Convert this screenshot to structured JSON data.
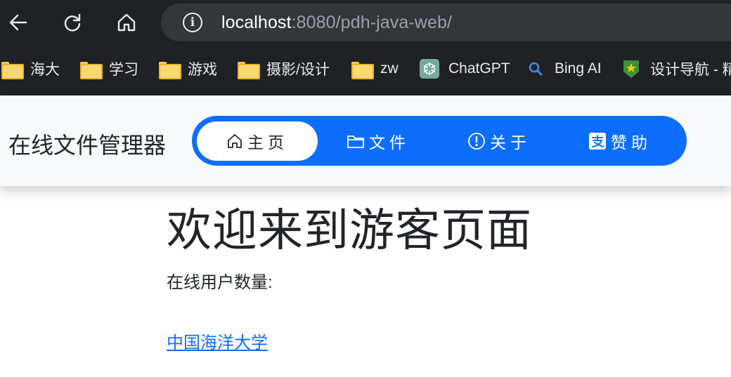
{
  "browser": {
    "url_host": "localhost",
    "url_path": ":8080/pdh-java-web/",
    "bookmarks": [
      {
        "label": "海大",
        "icon": "folder-icon"
      },
      {
        "label": "学习",
        "icon": "folder-icon"
      },
      {
        "label": "游戏",
        "icon": "folder-icon"
      },
      {
        "label": "摄影/设计",
        "icon": "folder-icon"
      },
      {
        "label": "zw",
        "icon": "folder-icon"
      },
      {
        "label": "ChatGPT",
        "icon": "chatgpt-icon"
      },
      {
        "label": "Bing AI",
        "icon": "search-icon"
      },
      {
        "label": "设计导航 - 精",
        "icon": "star-shield-icon"
      }
    ]
  },
  "site": {
    "brand": "在线文件管理器",
    "nav": [
      {
        "label": "主页",
        "icon": "home-icon",
        "active": true
      },
      {
        "label": "文件",
        "icon": "folder-icon",
        "active": false
      },
      {
        "label": "关于",
        "icon": "exclamation-circle-icon",
        "active": false
      },
      {
        "label": "赞助",
        "icon": "alipay-icon",
        "active": false
      }
    ]
  },
  "main": {
    "heading": "欢迎来到游客页面",
    "online_users_label": "在线用户数量:",
    "link_text": "中国海洋大学"
  },
  "colors": {
    "chrome_bg": "#202124",
    "omnibox_bg": "#35363a",
    "nav_blue": "#0d6efd",
    "header_bg": "#f8f9fa"
  }
}
